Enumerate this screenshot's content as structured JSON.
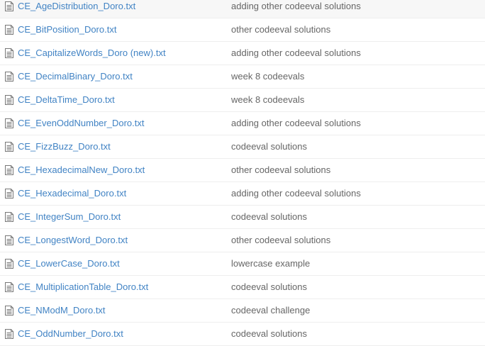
{
  "files": [
    {
      "name": "CE_AgeDistribution_Doro.txt",
      "message": "adding other codeeval solutions"
    },
    {
      "name": "CE_BitPosition_Doro.txt",
      "message": "other codeeval solutions"
    },
    {
      "name": "CE_CapitalizeWords_Doro (new).txt",
      "message": "adding other codeeval solutions"
    },
    {
      "name": "CE_DecimalBinary_Doro.txt",
      "message": "week 8 codeevals"
    },
    {
      "name": "CE_DeltaTime_Doro.txt",
      "message": "week 8 codeevals"
    },
    {
      "name": "CE_EvenOddNumber_Doro.txt",
      "message": "adding other codeeval solutions"
    },
    {
      "name": "CE_FizzBuzz_Doro.txt",
      "message": "codeeval solutions"
    },
    {
      "name": "CE_HexadecimalNew_Doro.txt",
      "message": "other codeeval solutions"
    },
    {
      "name": "CE_Hexadecimal_Doro.txt",
      "message": "adding other codeeval solutions"
    },
    {
      "name": "CE_IntegerSum_Doro.txt",
      "message": "codeeval solutions"
    },
    {
      "name": "CE_LongestWord_Doro.txt",
      "message": "other codeeval solutions"
    },
    {
      "name": "CE_LowerCase_Doro.txt",
      "message": "lowercase example"
    },
    {
      "name": "CE_MultiplicationTable_Doro.txt",
      "message": "codeeval solutions"
    },
    {
      "name": "CE_NModM_Doro.txt",
      "message": "codeeval challenge"
    },
    {
      "name": "CE_OddNumber_Doro.txt",
      "message": "codeeval solutions"
    }
  ],
  "icon": "file-text-icon",
  "colors": {
    "link": "#4183c4",
    "message": "#666666",
    "border": "#eeeeee",
    "hover_row": "#f7f7f7"
  }
}
